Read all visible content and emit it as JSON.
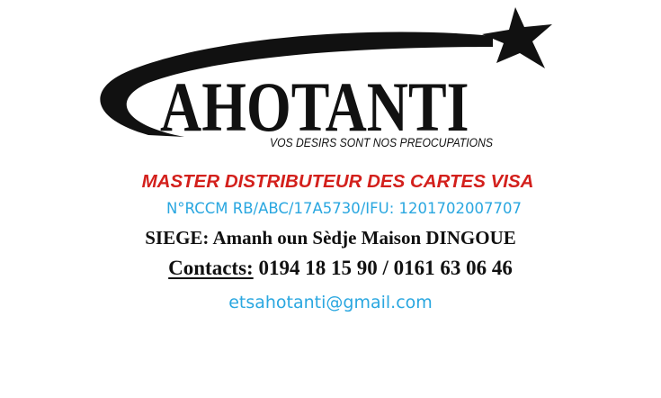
{
  "logo": {
    "name": "AHOTANTI",
    "tagline": "VOS DESIRS SONT NOS PREOCUPATIONS"
  },
  "info": {
    "headline": "MASTER DISTRIBUTEUR DES CARTES VISA",
    "registration": "N°RCCM RB/ABC/17A5730/IFU: 1201702007707",
    "address": "SIEGE: Amanh oun Sèdje Maison DINGOUE",
    "contacts_label": "Contacts:",
    "contacts_numbers": "0194 18 15 90 / 0161 63 06 46",
    "email": "etsahotanti@gmail.com"
  },
  "colors": {
    "headline": "#d3201c",
    "accent_blue": "#2aa7e0",
    "text": "#111111",
    "background": "#ffffff"
  }
}
